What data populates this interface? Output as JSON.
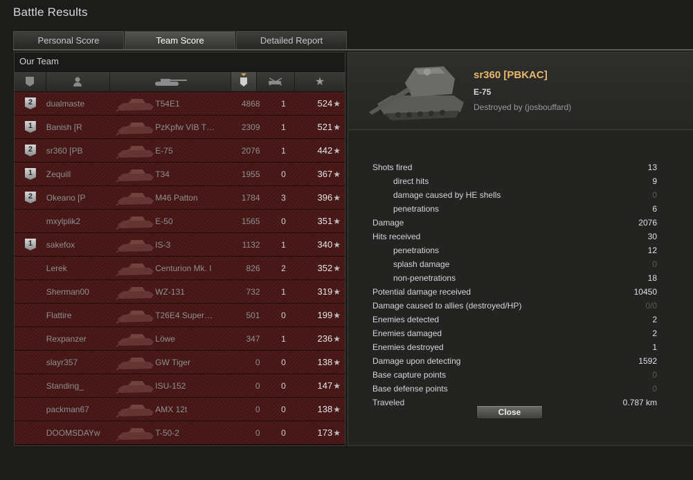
{
  "window": {
    "title": "Battle Results"
  },
  "tabs": [
    {
      "label": "Personal Score",
      "active": false
    },
    {
      "label": "Team Score",
      "active": true
    },
    {
      "label": "Detailed Report",
      "active": false
    }
  ],
  "team": {
    "label": "Our Team",
    "columns": [
      "medal-icon",
      "player-icon",
      "tank-icon",
      "xp-icon",
      "kills-icon",
      "score-star-icon"
    ],
    "rows": [
      {
        "medal": "2",
        "player": "dualmaste",
        "tank": "T54E1",
        "xp": "4868",
        "kills": "1",
        "score": "524"
      },
      {
        "medal": "1",
        "player": "Banish [R",
        "tank": "PzKpfw VIB T…",
        "xp": "2309",
        "kills": "1",
        "score": "521"
      },
      {
        "medal": "2",
        "player": "sr360 [PB",
        "tank": "E-75",
        "xp": "2076",
        "kills": "1",
        "score": "442"
      },
      {
        "medal": "1",
        "player": "Zequill",
        "tank": "T34",
        "xp": "1955",
        "kills": "0",
        "score": "367"
      },
      {
        "medal": "2",
        "player": "Okeano [P",
        "tank": "M46 Patton",
        "xp": "1784",
        "kills": "3",
        "score": "396"
      },
      {
        "medal": "",
        "player": "mxylplik2",
        "tank": "E-50",
        "xp": "1565",
        "kills": "0",
        "score": "351"
      },
      {
        "medal": "1",
        "player": "sakefox",
        "tank": "IS-3",
        "xp": "1132",
        "kills": "1",
        "score": "340"
      },
      {
        "medal": "",
        "player": "Lerek",
        "tank": "Centurion Mk. I",
        "xp": "826",
        "kills": "2",
        "score": "352"
      },
      {
        "medal": "",
        "player": "Sherman00",
        "tank": "WZ-131",
        "xp": "732",
        "kills": "1",
        "score": "319"
      },
      {
        "medal": "",
        "player": "Flattire",
        "tank": "T26E4 Super…",
        "xp": "501",
        "kills": "0",
        "score": "199"
      },
      {
        "medal": "",
        "player": "Rexpanzer",
        "tank": "Löwe",
        "xp": "347",
        "kills": "1",
        "score": "236"
      },
      {
        "medal": "",
        "player": "slayr357",
        "tank": "GW Tiger",
        "xp": "0",
        "kills": "0",
        "score": "138"
      },
      {
        "medal": "",
        "player": "Standing_",
        "tank": "ISU-152",
        "xp": "0",
        "kills": "0",
        "score": "147"
      },
      {
        "medal": "",
        "player": "packman67",
        "tank": "AMX 12t",
        "xp": "0",
        "kills": "0",
        "score": "138"
      },
      {
        "medal": "",
        "player": "DOOMSDAYw",
        "tank": "T-50-2",
        "xp": "0",
        "kills": "0",
        "score": "173"
      }
    ]
  },
  "details": {
    "player_name": "sr360 [PBKAC]",
    "tank": "E-75",
    "destroyed_by": "Destroyed by (josbouffard)",
    "stats": [
      {
        "label": "Shots fired",
        "value": "13",
        "sub": false,
        "dim": false
      },
      {
        "label": "direct hits",
        "value": "9",
        "sub": true,
        "dim": false
      },
      {
        "label": "damage caused by HE shells",
        "value": "0",
        "sub": true,
        "dim": true
      },
      {
        "label": "penetrations",
        "value": "6",
        "sub": true,
        "dim": false
      },
      {
        "label": "Damage",
        "value": "2076",
        "sub": false,
        "dim": false
      },
      {
        "label": "Hits received",
        "value": "30",
        "sub": false,
        "dim": false
      },
      {
        "label": "penetrations",
        "value": "12",
        "sub": true,
        "dim": false
      },
      {
        "label": "splash damage",
        "value": "0",
        "sub": true,
        "dim": true
      },
      {
        "label": "non-penetrations",
        "value": "18",
        "sub": true,
        "dim": false
      },
      {
        "label": "Potential damage received",
        "value": "10450",
        "sub": false,
        "dim": false
      },
      {
        "label": "Damage caused to allies (destroyed/HP)",
        "value": "0/0",
        "sub": false,
        "dim": true
      },
      {
        "label": "Enemies detected",
        "value": "2",
        "sub": false,
        "dim": false
      },
      {
        "label": "Enemies damaged",
        "value": "2",
        "sub": false,
        "dim": false
      },
      {
        "label": "Enemies destroyed",
        "value": "1",
        "sub": false,
        "dim": false
      },
      {
        "label": "Damage upon detecting",
        "value": "1592",
        "sub": false,
        "dim": false
      },
      {
        "label": "Base capture points",
        "value": "0",
        "sub": false,
        "dim": true
      },
      {
        "label": "Base defense points",
        "value": "0",
        "sub": false,
        "dim": true
      },
      {
        "label": "Traveled",
        "value": "0.787 km",
        "sub": false,
        "dim": false
      }
    ],
    "close_label": "Close"
  },
  "colors": {
    "accent": "#e7b86b",
    "row_bg": "#4c1a1a",
    "panel_bg": "#232321"
  }
}
